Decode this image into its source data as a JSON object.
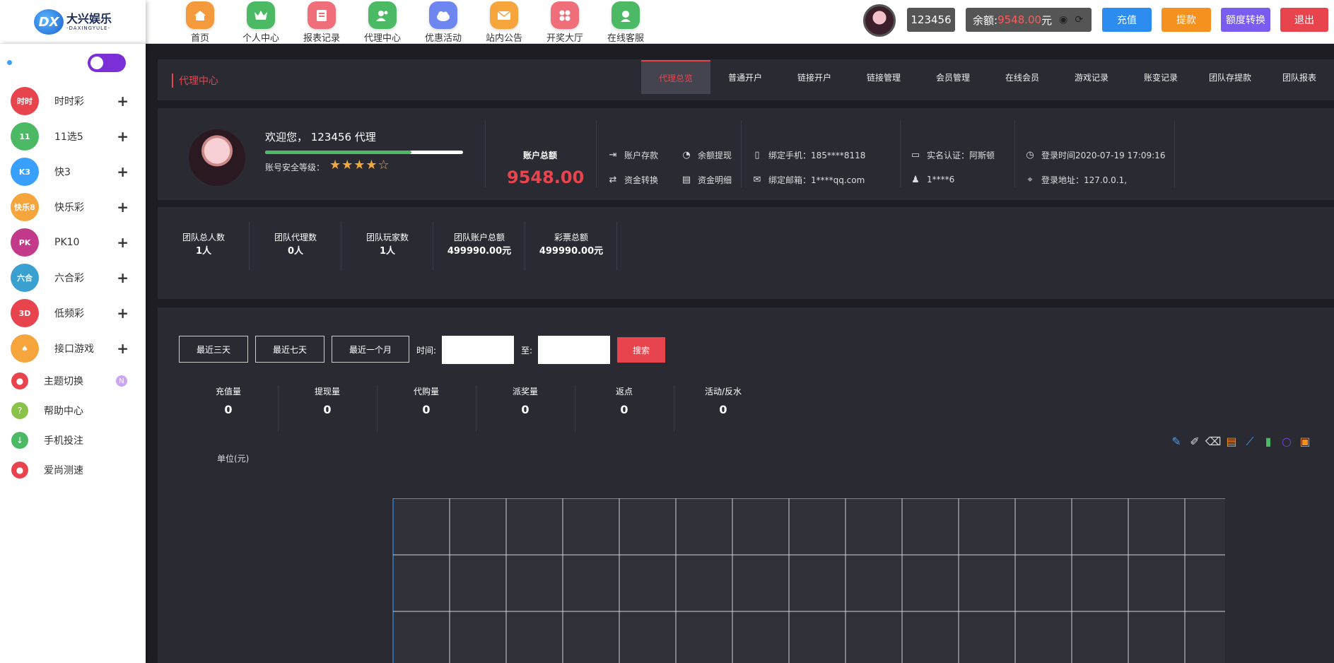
{
  "brand": {
    "name": "大兴娱乐",
    "sub": "-DAXINGYULE-"
  },
  "nav": [
    {
      "label": "首页",
      "icon": "home-icon",
      "color": "#f59a3c"
    },
    {
      "label": "个人中心",
      "icon": "crown-icon",
      "color": "#4cba65"
    },
    {
      "label": "报表记录",
      "icon": "report-icon",
      "color": "#f06d7a"
    },
    {
      "label": "代理中心",
      "icon": "agent-icon",
      "color": "#4cba65"
    },
    {
      "label": "优惠活动",
      "icon": "gift-cloud-icon",
      "color": "#6e86f0"
    },
    {
      "label": "站内公告",
      "icon": "mail-icon",
      "color": "#f5a53c"
    },
    {
      "label": "开奖大厅",
      "icon": "grid-icon",
      "color": "#f06d7a"
    },
    {
      "label": "在线客服",
      "icon": "support-icon",
      "color": "#4cba65"
    }
  ],
  "top": {
    "username": "123456",
    "balance_label": "余额:",
    "balance_amount": "9548.00",
    "balance_unit": "元",
    "buttons": [
      {
        "label": "充值",
        "color": "#2d8cf0"
      },
      {
        "label": "提款",
        "color": "#f5911e"
      },
      {
        "label": "额度转换",
        "color": "#7a5cf0"
      },
      {
        "label": "退出",
        "color": "#e8444d"
      }
    ]
  },
  "sidebar": {
    "lotteries": [
      {
        "label": "时时彩",
        "ball": "时时",
        "color": "#e8444d"
      },
      {
        "label": "11选5",
        "ball": "11",
        "color": "#4cba65"
      },
      {
        "label": "快3",
        "ball": "K3",
        "color": "#39a0ff"
      },
      {
        "label": "快乐彩",
        "ball": "快乐8",
        "color": "#f5a53c"
      },
      {
        "label": "PK10",
        "ball": "PK",
        "color": "#c33a8a"
      },
      {
        "label": "六合彩",
        "ball": "六合",
        "color": "#3aa0d0"
      },
      {
        "label": "低频彩",
        "ball": "3D",
        "color": "#e8444d"
      },
      {
        "label": "接口游戏",
        "ball": "♠",
        "color": "#f5a53c"
      }
    ],
    "tools": [
      {
        "label": "主题切换",
        "color": "#e8444d",
        "badge": "N"
      },
      {
        "label": "帮助中心",
        "color": "#8bc34a"
      },
      {
        "label": "手机投注",
        "color": "#4cba65"
      },
      {
        "label": "爱尚测速",
        "color": "#e8444d"
      }
    ]
  },
  "header": {
    "title": "代理中心",
    "tabs": [
      "代理总览",
      "普通开户",
      "链接开户",
      "链接管理",
      "会员管理",
      "在线会员",
      "游戏记录",
      "账变记录",
      "团队存提款",
      "团队报表"
    ]
  },
  "profile": {
    "welcome": "欢迎您， 123456 代理",
    "security_label": "账号安全等级：",
    "security_level": 0.74,
    "stars_filled": 4,
    "stars_total": 5,
    "total_label": "账户总额",
    "total_amount": "9548.00",
    "actions": [
      "账户存款",
      "余额提现",
      "资金转换",
      "资金明细"
    ],
    "phone": "绑定手机：185****8118",
    "email": "绑定邮箱：1****qq.com",
    "realname": "实名认证：阿斯顿",
    "qq": "1****6",
    "login_time": "登录时间2020-07-19 17:09:16",
    "login_ip": "登录地址：127.0.0.1,"
  },
  "team": [
    {
      "label": "团队总人数",
      "value": "1人"
    },
    {
      "label": "团队代理数",
      "value": "0人"
    },
    {
      "label": "团队玩家数",
      "value": "1人"
    },
    {
      "label": "团队账户总额",
      "value": "499990.00元"
    },
    {
      "label": "彩票总额",
      "value": "499990.00元"
    }
  ],
  "filter": {
    "quick": [
      "最近三天",
      "最近七天",
      "最近一个月"
    ],
    "time_label": "时间:",
    "to_label": "至:",
    "search": "搜索"
  },
  "metrics": [
    {
      "label": "充值量",
      "value": "0"
    },
    {
      "label": "提现量",
      "value": "0"
    },
    {
      "label": "代购量",
      "value": "0"
    },
    {
      "label": "派奖量",
      "value": "0"
    },
    {
      "label": "返点",
      "value": "0"
    },
    {
      "label": "活动/反水",
      "value": "0"
    }
  ],
  "chart": {
    "unit_label": "单位(元)",
    "tools": [
      {
        "icon": "pencil-icon",
        "color": "#39a0ff"
      },
      {
        "icon": "eraser-icon",
        "color": "#ddd"
      },
      {
        "icon": "trash-icon",
        "color": "#ddd"
      },
      {
        "icon": "document-icon",
        "color": "#f5911e"
      },
      {
        "icon": "line-chart-icon",
        "color": "#39a0ff"
      },
      {
        "icon": "bar-chart-icon",
        "color": "#4cba65"
      },
      {
        "icon": "circle-icon",
        "color": "#7a3fd6"
      },
      {
        "icon": "save-icon",
        "color": "#f5911e"
      }
    ]
  }
}
